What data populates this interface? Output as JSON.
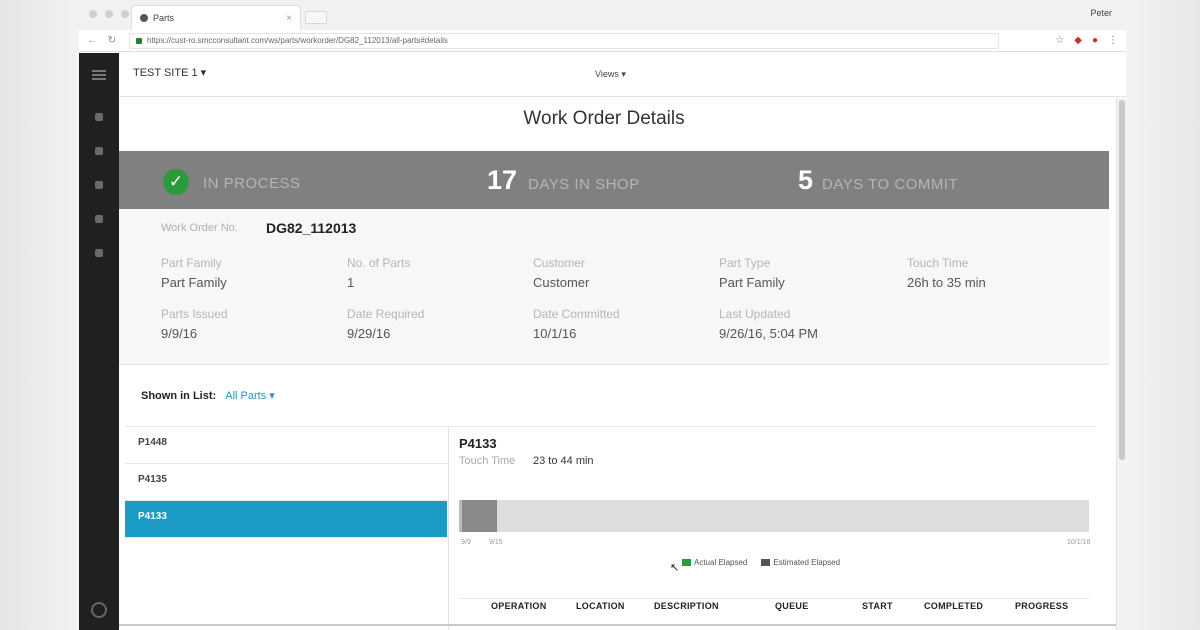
{
  "browser": {
    "tab_title": "Parts",
    "profile": "Peter",
    "url": "https://cust-ro.smcconsultant.com/ws/parts/workorder/DG82_112013/all-parts#details"
  },
  "app": {
    "site_selector": "TEST SITE 1",
    "view_selector": "Views"
  },
  "page": {
    "title": "Work Order Details"
  },
  "banner": {
    "status": "IN PROCESS",
    "days_in_shop": "17",
    "days_in_shop_label": "DAYS IN SHOP",
    "days_to_commit": "5",
    "days_to_commit_label": "DAYS TO COMMIT"
  },
  "details": {
    "work_order_label": "Work Order No.",
    "work_order_value": "DG82_112013",
    "fields": [
      {
        "label": "Part Family",
        "value": "Part Family"
      },
      {
        "label": "No. of Parts",
        "value": "1"
      },
      {
        "label": "Customer",
        "value": "Customer"
      },
      {
        "label": "Part Type",
        "value": "Part Family"
      },
      {
        "label": "Touch Time",
        "value": "26h to 35 min"
      },
      {
        "label": "Parts Issued",
        "value": "9/9/16"
      },
      {
        "label": "Date Required",
        "value": "9/29/16"
      },
      {
        "label": "Date Committed",
        "value": "10/1/16"
      },
      {
        "label": "Last Updated",
        "value": "9/26/16, 5:04 PM"
      }
    ]
  },
  "parts": {
    "shown_label": "Shown in List:",
    "shown_value": "All Parts",
    "list": [
      "P1448",
      "P4135",
      "P4133"
    ],
    "active_index": 2,
    "detail": {
      "id": "P4133",
      "touch_label": "Touch Time",
      "touch_value": "23 to 44 min"
    },
    "progress": {
      "fraction": 0.06,
      "tick_start": "9/9",
      "tick_mid": "9/15",
      "tick_end": "10/1/16"
    },
    "legend": [
      {
        "label": "Actual Elapsed",
        "color": "#2b9a3a"
      },
      {
        "label": "Estimated Elapsed",
        "color": "#555555"
      }
    ],
    "columns": [
      "OPERATION",
      "LOCATION",
      "DESCRIPTION",
      "QUEUE",
      "START",
      "COMPLETED",
      "PROGRESS"
    ]
  }
}
